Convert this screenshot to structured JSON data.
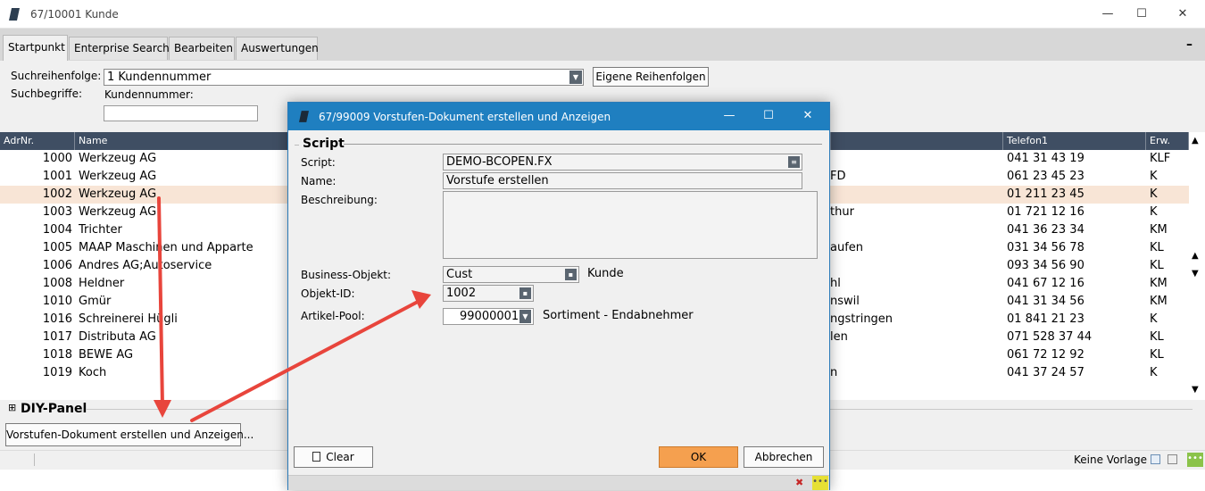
{
  "main_window": {
    "title": "67/10001 Kunde",
    "controls": {
      "minimize": "—",
      "maximize": "☐",
      "close": "✕"
    }
  },
  "tabs": [
    {
      "label": "Startpunkt",
      "active": true
    },
    {
      "label": "Enterprise Search"
    },
    {
      "label": "Bearbeiten"
    },
    {
      "label": "Auswertungen"
    }
  ],
  "collapse_symbol": "–",
  "search": {
    "order_label": "Suchreihenfolge:",
    "order_value": "1 Kundennummer",
    "custom_order_button": "Eigene Reihenfolgen",
    "terms_label": "Suchbegriffe:",
    "customer_number_label": "Kundennummer:",
    "customer_number_value": ""
  },
  "table": {
    "columns": {
      "adrnr": "AdrNr.",
      "name": "Name",
      "telefon": "Telefon1",
      "erw": "Erw."
    },
    "rows": [
      {
        "adrnr": "1000",
        "name": "Werkzeug AG",
        "ort": "",
        "telefon": "041 31 43 19",
        "erw": "KLF"
      },
      {
        "adrnr": "1001",
        "name": "Werkzeug AG",
        "ort": "FD",
        "telefon": "061 23 45 23",
        "erw": "K"
      },
      {
        "adrnr": "1002",
        "name": "Werkzeug AG",
        "ort": "",
        "telefon": "01 211 23 45",
        "erw": "K"
      },
      {
        "adrnr": "1003",
        "name": "Werkzeug AG",
        "ort": "thur",
        "telefon": "01 721 12 16",
        "erw": "K"
      },
      {
        "adrnr": "1004",
        "name": "Trichter",
        "ort": "",
        "telefon": "041 36 23 34",
        "erw": "KM"
      },
      {
        "adrnr": "1005",
        "name": "MAAP Maschinen und Apparte",
        "ort": "aufen",
        "telefon": "031 34 56 78",
        "erw": "KL"
      },
      {
        "adrnr": "1006",
        "name": "Andres AG;Autoservice",
        "ort": "",
        "telefon": "093 34 56 90",
        "erw": "KL"
      },
      {
        "adrnr": "1008",
        "name": "Heldner",
        "ort": "hl",
        "telefon": "041 67 12 16",
        "erw": "KM"
      },
      {
        "adrnr": "1010",
        "name": "Gmür",
        "ort": "nswil",
        "telefon": "041 31 34 56",
        "erw": "KM"
      },
      {
        "adrnr": "1016",
        "name": "Schreinerei Hügli",
        "ort": "ngstringen",
        "telefon": "01 841 21 23",
        "erw": "K"
      },
      {
        "adrnr": "1017",
        "name": "Distributa AG",
        "ort": "len",
        "telefon": "071  528 37 44",
        "erw": "KL"
      },
      {
        "adrnr": "1018",
        "name": "BEWE AG",
        "ort": "",
        "telefon": "061 72 12 92",
        "erw": "KL"
      },
      {
        "adrnr": "1019",
        "name": "Koch",
        "ort": "n",
        "telefon": "041 37 24 57",
        "erw": "K"
      }
    ]
  },
  "diy_panel": {
    "expand_symbol": "⊞",
    "title": "DIY-Panel",
    "action_button": "Vorstufen-Dokument erstellen und Anzeigen..."
  },
  "status": {
    "template": "Keine Vorlage",
    "indicator": "•••"
  },
  "dialog": {
    "title": "67/99009 Vorstufen-Dokument erstellen und Anzeigen",
    "controls": {
      "minimize": "—",
      "maximize": "☐",
      "close": "✕"
    },
    "section": "Script",
    "script_label": "Script:",
    "script_value": "DEMO-BCOPEN.FX",
    "name_label": "Name:",
    "name_value": "Vorstufe erstellen",
    "description_label": "Beschreibung:",
    "description_value": "",
    "business_object_label": "Business-Objekt:",
    "business_object_value": "Cust",
    "business_object_text": "Kunde",
    "object_id_label": "Objekt-ID:",
    "object_id_value": "1002",
    "article_pool_label": "Artikel-Pool:",
    "article_pool_value": "99000001",
    "article_pool_text": "Sortiment - Endabnehmer",
    "clear_button": "Clear",
    "ok_button": "OK",
    "cancel_button": "Abbrechen",
    "status_indicator": "•••"
  },
  "colors": {
    "header_bg": "#3f4e63",
    "selected_row": "#f8e5d6",
    "dialog_title": "#1f7fc0",
    "ok_button": "#f5a04f",
    "arrow": "#e8453c",
    "indicator": "#8bc34a"
  }
}
